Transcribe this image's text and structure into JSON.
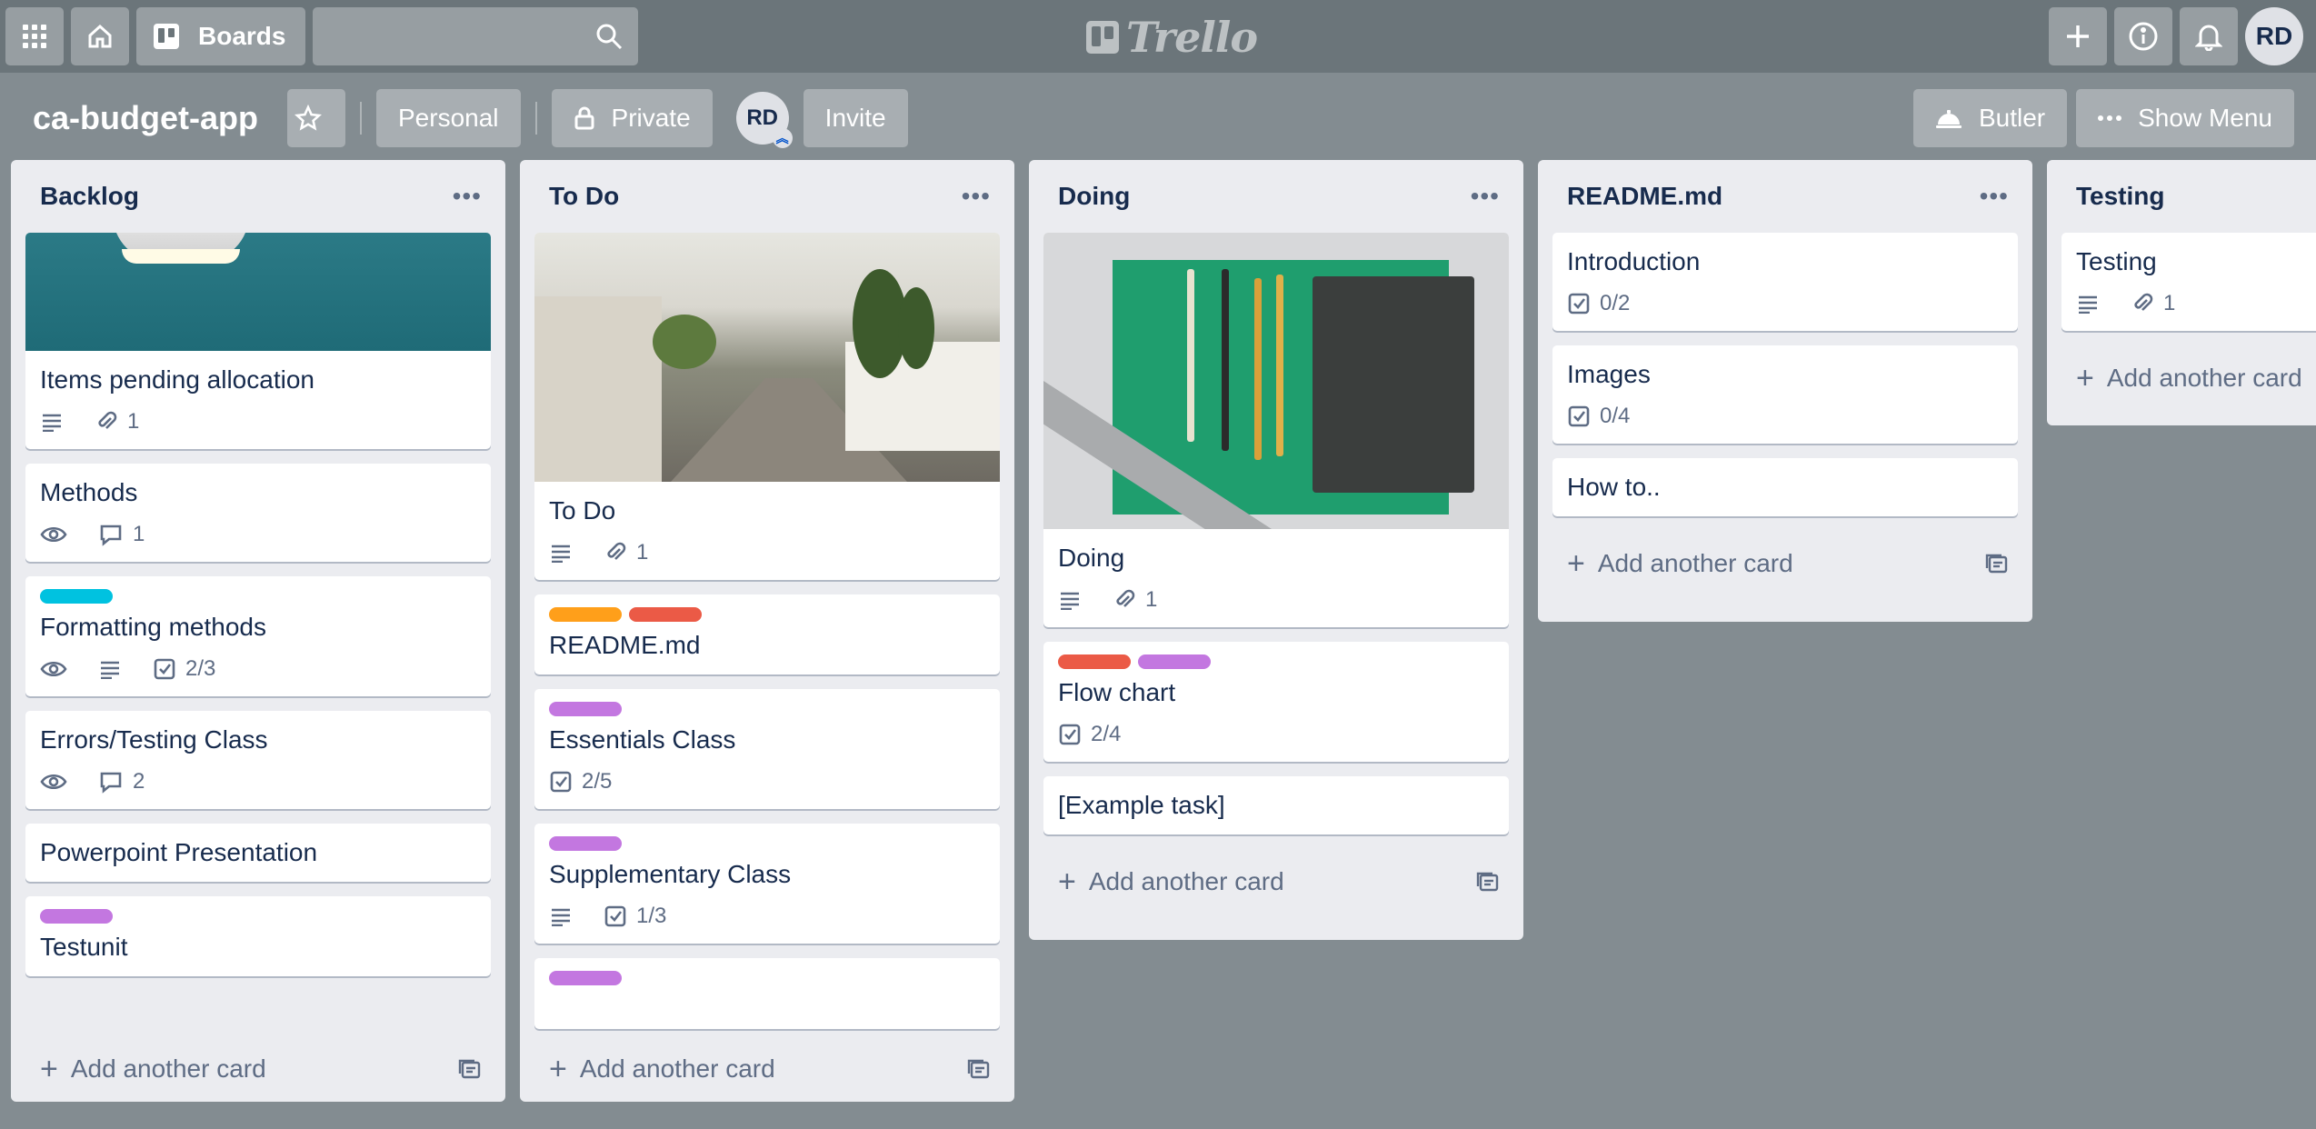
{
  "header": {
    "boards_label": "Boards",
    "logo_text": "Trello",
    "user_initials": "RD"
  },
  "board": {
    "title": "ca-budget-app",
    "team": "Personal",
    "visibility": "Private",
    "member_initials": "RD",
    "invite_label": "Invite",
    "butler_label": "Butler",
    "show_menu_label": "Show Menu"
  },
  "colors": {
    "label_cyan": "#00c2e0",
    "label_orange": "#ff9f1a",
    "label_red": "#eb5a46",
    "label_purple": "#c377e0"
  },
  "lists": [
    {
      "title": "Backlog",
      "add_label": "Add another card",
      "cards": [
        {
          "title": "Items pending allocation",
          "badges": {
            "description": true,
            "attachments": "1"
          }
        },
        {
          "title": "Methods",
          "badges": {
            "watch": true,
            "comments": "1"
          }
        },
        {
          "title": "Formatting methods",
          "labels": [
            "cyan"
          ],
          "badges": {
            "watch": true,
            "description": true,
            "checklist": "2/3"
          }
        },
        {
          "title": "Errors/Testing Class",
          "badges": {
            "watch": true,
            "comments": "2"
          }
        },
        {
          "title": "Powerpoint Presentation"
        },
        {
          "title": "Testunit",
          "labels": [
            "purple"
          ]
        }
      ]
    },
    {
      "title": "To Do",
      "add_label": "Add another card",
      "cards": [
        {
          "title": "To Do",
          "badges": {
            "description": true,
            "attachments": "1"
          }
        },
        {
          "title": "README.md",
          "labels": [
            "orange",
            "red"
          ]
        },
        {
          "title": "Essentials Class",
          "labels": [
            "purple"
          ],
          "badges": {
            "checklist": "2/5"
          }
        },
        {
          "title": "Supplementary Class",
          "labels": [
            "purple"
          ],
          "badges": {
            "description": true,
            "checklist": "1/3"
          }
        }
      ]
    },
    {
      "title": "Doing",
      "add_label": "Add another card",
      "cards": [
        {
          "title": "Doing",
          "badges": {
            "description": true,
            "attachments": "1"
          }
        },
        {
          "title": "Flow chart",
          "labels": [
            "red",
            "purple"
          ],
          "badges": {
            "checklist": "2/4"
          }
        },
        {
          "title": "[Example task]"
        }
      ]
    },
    {
      "title": "README.md",
      "add_label": "Add another card",
      "cards": [
        {
          "title": "Introduction",
          "badges": {
            "checklist": "0/2"
          }
        },
        {
          "title": "Images",
          "badges": {
            "checklist": "0/4"
          }
        },
        {
          "title": "How to.."
        }
      ]
    },
    {
      "title": "Testing",
      "add_label": "Add another card",
      "cards": [
        {
          "title": "Testing",
          "badges": {
            "description": true,
            "attachments": "1"
          }
        }
      ]
    }
  ]
}
